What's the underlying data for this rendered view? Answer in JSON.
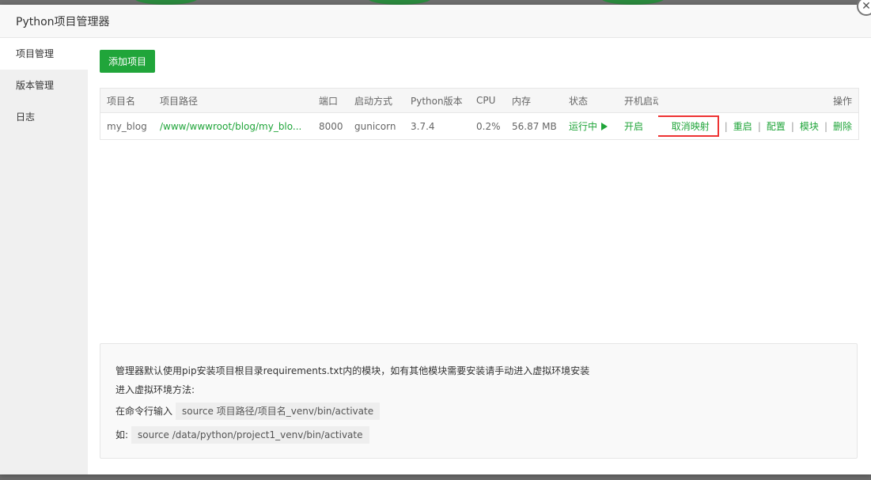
{
  "dialog": {
    "title": "Python项目管理器",
    "close_icon": "close-icon"
  },
  "sidebar": {
    "items": [
      {
        "label": "项目管理",
        "active": true
      },
      {
        "label": "版本管理",
        "active": false
      },
      {
        "label": "日志",
        "active": false
      }
    ]
  },
  "toolbar": {
    "add_label": "添加项目"
  },
  "table": {
    "headers": {
      "name": "项目名",
      "path": "项目路径",
      "port": "端口",
      "mode": "启动方式",
      "pyver": "Python版本",
      "cpu": "CPU",
      "mem": "内存",
      "status": "状态",
      "boot": "开机启动",
      "ops": "操作"
    },
    "rows": [
      {
        "name": "my_blog",
        "path": "/www/wwwroot/blog/my_blo...",
        "port": "8000",
        "mode": "gunicorn",
        "pyver": "3.7.4",
        "cpu": "0.2%",
        "mem": "56.87 MB",
        "status": "运行中",
        "boot": "开启",
        "ops": {
          "unmap": "取消映射",
          "restart": "重启",
          "config": "配置",
          "module": "模块",
          "delete": "删除",
          "separator": "|"
        }
      }
    ]
  },
  "note": {
    "line1": "管理器默认使用pip安装项目根目录requirements.txt内的模块，如有其他模块需要安装请手动进入虚拟环境安装",
    "line2": "进入虚拟环境方法:",
    "line3_prefix": "在命令行输入",
    "line3_code": "source 项目路径/项目名_venv/bin/activate",
    "line4_prefix": "如:",
    "line4_code": "source /data/python/project1_venv/bin/activate"
  },
  "colors": {
    "accent": "#20a53a",
    "highlight": "#ee3333"
  }
}
